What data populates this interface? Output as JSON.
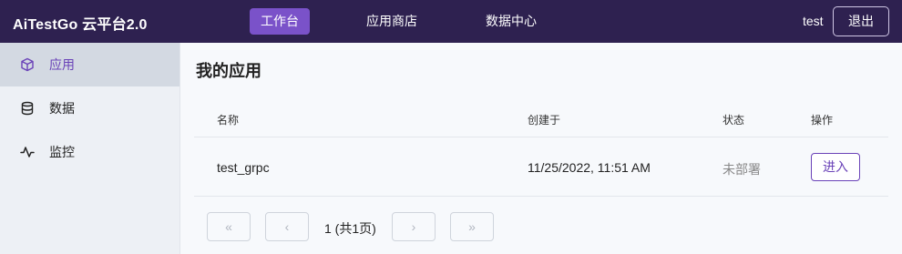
{
  "header": {
    "brand": "AiTestGo 云平台2.0",
    "nav": [
      {
        "label": "工作台",
        "active": true
      },
      {
        "label": "应用商店",
        "active": false
      },
      {
        "label": "数据中心",
        "active": false
      }
    ],
    "username": "test",
    "logout_label": "退出"
  },
  "sidebar": {
    "items": [
      {
        "label": "应用",
        "icon": "cube-icon",
        "active": true
      },
      {
        "label": "数据",
        "icon": "database-icon",
        "active": false
      },
      {
        "label": "监控",
        "icon": "activity-icon",
        "active": false
      }
    ]
  },
  "main": {
    "title": "我的应用",
    "table": {
      "columns": [
        "名称",
        "创建于",
        "状态",
        "操作"
      ],
      "rows": [
        {
          "name": "test_grpc",
          "created": "11/25/2022, 11:51 AM",
          "status": "未部署",
          "action": "进入"
        }
      ]
    },
    "pagination": {
      "first": "«",
      "prev": "‹",
      "info": "1 (共1页)",
      "next": "›",
      "last": "»"
    }
  },
  "colors": {
    "topbar": "#2e2150",
    "accent": "#7a52c9",
    "accent_text": "#6a42b8"
  }
}
